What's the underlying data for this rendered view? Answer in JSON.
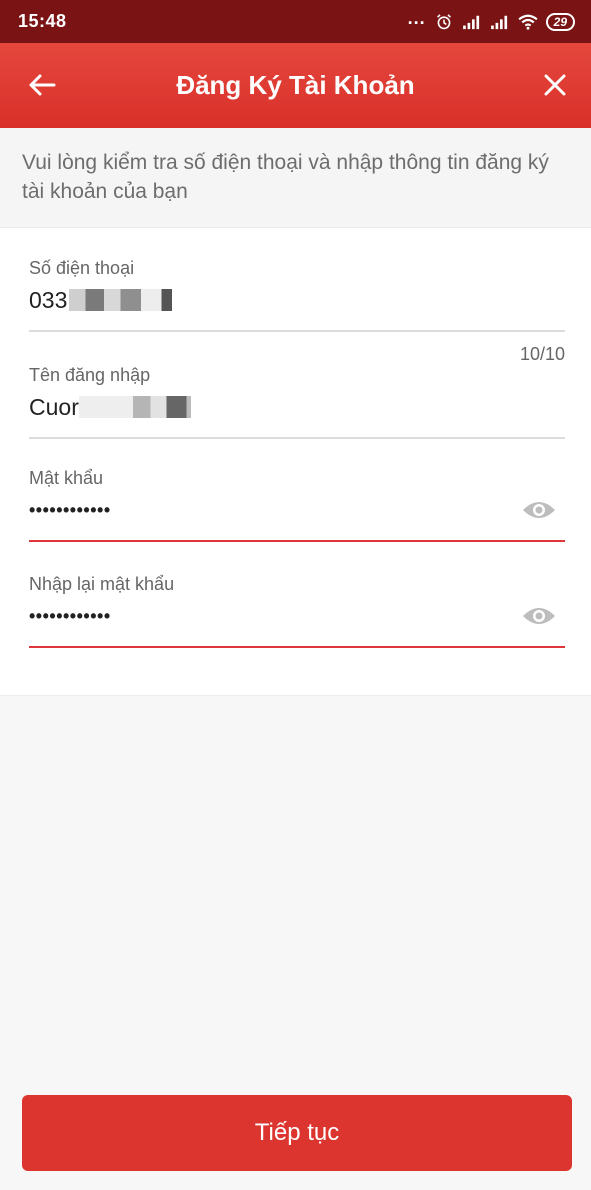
{
  "status_bar": {
    "time": "15:48",
    "dots": "...",
    "battery": "29",
    "icons": [
      "alarm-icon",
      "signal-icon",
      "signal-icon",
      "wifi-icon",
      "battery-icon"
    ]
  },
  "header": {
    "title": "Đăng Ký Tài Khoản",
    "back_icon": "arrow-left-icon",
    "close_icon": "close-icon",
    "color": "#dc3530"
  },
  "info": {
    "text": "Vui lòng kiểm tra số điện thoại và nhập thông tin đăng ký tài khoản của bạn"
  },
  "form": {
    "phone": {
      "label": "Số điện thoại",
      "value_visible": "033",
      "counter": "10/10"
    },
    "username": {
      "label": "Tên đăng nhập",
      "value_visible": "Cuor"
    },
    "password": {
      "label": "Mật khẩu",
      "value": "••••••••••••",
      "eye_icon": "eye-icon"
    },
    "confirm_password": {
      "label": "Nhập lại mật khẩu",
      "value": "••••••••••••",
      "eye_icon": "eye-icon"
    }
  },
  "actions": {
    "continue_label": "Tiếp tục"
  }
}
